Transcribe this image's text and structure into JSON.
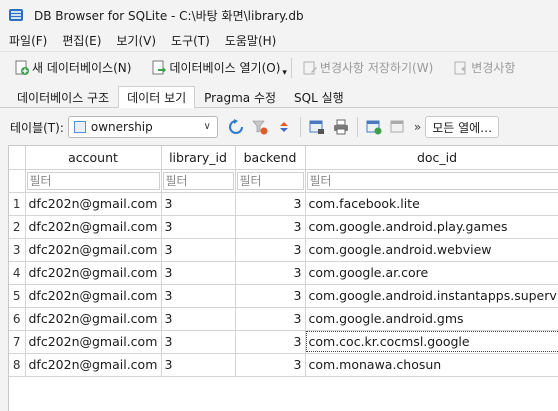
{
  "window": {
    "title": "DB Browser for SQLite - C:\\바탕 화면\\library.db"
  },
  "menu": [
    "파일(F)",
    "편집(E)",
    "보기(V)",
    "도구(T)",
    "도움말(H)"
  ],
  "toolbar": {
    "new_db": "새 데이터베이스(N)",
    "open_db": "데이터베이스 열기(O)",
    "write_changes": "변경사항 저장하기(W)",
    "revert_changes": "변경사항"
  },
  "tabs": [
    "데이터베이스 구조",
    "데이터 보기",
    "Pragma 수정",
    "SQL 실행"
  ],
  "table_bar": {
    "label": "테이블(T):",
    "selected_table": "ownership",
    "more": "»",
    "all_columns": "모든 열에…"
  },
  "grid": {
    "columns": [
      "account",
      "library_id",
      "backend",
      "doc_id"
    ],
    "filter_placeholder": "필터",
    "rows": [
      {
        "n": "1",
        "account": "dfc202n@gmail.com",
        "library_id": "3",
        "backend": "3",
        "doc_id": "com.facebook.lite"
      },
      {
        "n": "2",
        "account": "dfc202n@gmail.com",
        "library_id": "3",
        "backend": "3",
        "doc_id": "com.google.android.play.games"
      },
      {
        "n": "3",
        "account": "dfc202n@gmail.com",
        "library_id": "3",
        "backend": "3",
        "doc_id": "com.google.android.webview"
      },
      {
        "n": "4",
        "account": "dfc202n@gmail.com",
        "library_id": "3",
        "backend": "3",
        "doc_id": "com.google.ar.core"
      },
      {
        "n": "5",
        "account": "dfc202n@gmail.com",
        "library_id": "3",
        "backend": "3",
        "doc_id": "com.google.android.instantapps.superv"
      },
      {
        "n": "6",
        "account": "dfc202n@gmail.com",
        "library_id": "3",
        "backend": "3",
        "doc_id": "com.google.android.gms"
      },
      {
        "n": "7",
        "account": "dfc202n@gmail.com",
        "library_id": "3",
        "backend": "3",
        "doc_id": "com.coc.kr.cocmsl.google"
      },
      {
        "n": "8",
        "account": "dfc202n@gmail.com",
        "library_id": "3",
        "backend": "3",
        "doc_id": "com.monawa.chosun"
      }
    ]
  }
}
